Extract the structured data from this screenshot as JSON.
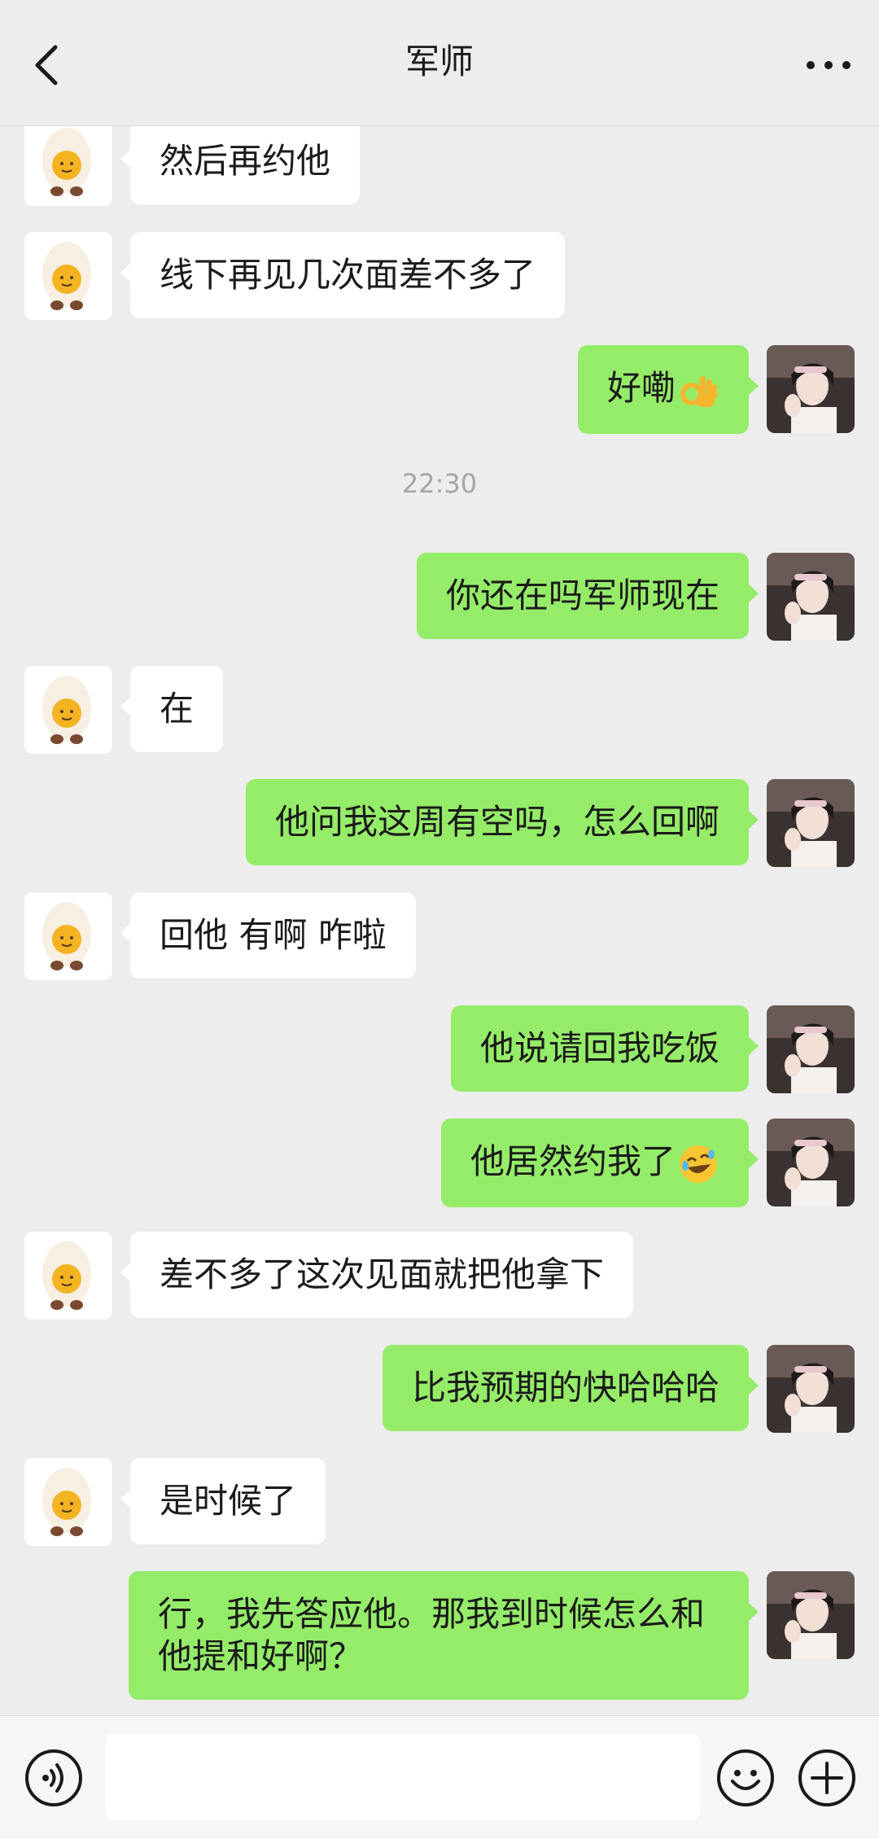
{
  "header": {
    "title": "军师",
    "back_icon": "chevron-left-icon",
    "more_icon": "more-dots-icon"
  },
  "timestamp": "22:30",
  "messages": [
    {
      "side": "left",
      "text": "然后再约他"
    },
    {
      "side": "left",
      "text": "线下再见几次面差不多了"
    },
    {
      "side": "right",
      "text": "好嘞",
      "emoji": "ok-hand-emoji"
    },
    {
      "side": "right",
      "text": "你还在吗军师现在"
    },
    {
      "side": "left",
      "text": "在"
    },
    {
      "side": "right",
      "text": "他问我这周有空吗，怎么回啊"
    },
    {
      "side": "left",
      "text": "回他 有啊 咋啦"
    },
    {
      "side": "right",
      "text": "他说请回我吃饭"
    },
    {
      "side": "right",
      "text": "他居然约我了",
      "emoji": "rolling-laughing-emoji"
    },
    {
      "side": "left",
      "text": "差不多了这次见面就把他拿下"
    },
    {
      "side": "right",
      "text": "比我预期的快哈哈哈"
    },
    {
      "side": "left",
      "text": "是时候了"
    },
    {
      "side": "right",
      "text": "行，我先答应他。那我到时候怎么和他提和好啊？"
    }
  ],
  "footer": {
    "input_value": "",
    "voice_icon": "voice-icon",
    "emoji_icon": "emoji-face-icon",
    "plus_icon": "plus-icon"
  },
  "colors": {
    "background": "#ededed",
    "sent_bubble": "#95ec69",
    "received_bubble": "#ffffff"
  }
}
